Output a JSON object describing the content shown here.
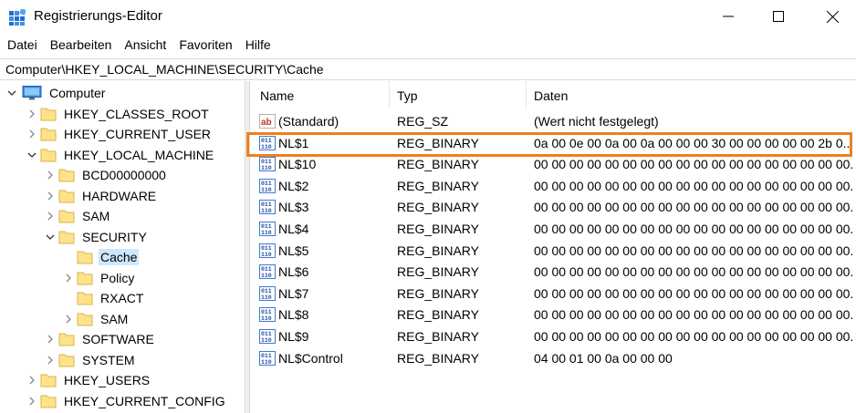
{
  "window": {
    "title": "Registrierungs-Editor"
  },
  "menu": [
    "Datei",
    "Bearbeiten",
    "Ansicht",
    "Favoriten",
    "Hilfe"
  ],
  "address": "Computer\\HKEY_LOCAL_MACHINE\\SECURITY\\Cache",
  "tree": [
    {
      "label": "Computer",
      "expanded": true
    },
    {
      "label": "HKEY_CLASSES_ROOT"
    },
    {
      "label": "HKEY_CURRENT_USER"
    },
    {
      "label": "HKEY_LOCAL_MACHINE",
      "expanded": true
    },
    {
      "label": "BCD00000000"
    },
    {
      "label": "HARDWARE"
    },
    {
      "label": "SAM"
    },
    {
      "label": "SECURITY",
      "expanded": true
    },
    {
      "label": "Cache",
      "selected": true
    },
    {
      "label": "Policy"
    },
    {
      "label": "RXACT"
    },
    {
      "label": "SAM"
    },
    {
      "label": "SOFTWARE"
    },
    {
      "label": "SYSTEM"
    },
    {
      "label": "HKEY_USERS"
    },
    {
      "label": "HKEY_CURRENT_CONFIG"
    }
  ],
  "columns": {
    "name": "Name",
    "type": "Typ",
    "data": "Daten"
  },
  "values": [
    {
      "name": "(Standard)",
      "type": "REG_SZ",
      "data": "(Wert nicht festgelegt)",
      "icon": "string-value-icon"
    },
    {
      "name": "NL$1",
      "type": "REG_BINARY",
      "data": "0a 00 0e 00 0a 00 0a 00 00 00 30 00 00 00 00 00 2b 0...",
      "icon": "binary-value-icon"
    },
    {
      "name": "NL$10",
      "type": "REG_BINARY",
      "data": "00 00 00 00 00 00 00 00 00 00 00 00 00 00 00 00 00 00...",
      "icon": "binary-value-icon"
    },
    {
      "name": "NL$2",
      "type": "REG_BINARY",
      "data": "00 00 00 00 00 00 00 00 00 00 00 00 00 00 00 00 00 00...",
      "icon": "binary-value-icon"
    },
    {
      "name": "NL$3",
      "type": "REG_BINARY",
      "data": "00 00 00 00 00 00 00 00 00 00 00 00 00 00 00 00 00 00...",
      "icon": "binary-value-icon"
    },
    {
      "name": "NL$4",
      "type": "REG_BINARY",
      "data": "00 00 00 00 00 00 00 00 00 00 00 00 00 00 00 00 00 00...",
      "icon": "binary-value-icon"
    },
    {
      "name": "NL$5",
      "type": "REG_BINARY",
      "data": "00 00 00 00 00 00 00 00 00 00 00 00 00 00 00 00 00 00...",
      "icon": "binary-value-icon"
    },
    {
      "name": "NL$6",
      "type": "REG_BINARY",
      "data": "00 00 00 00 00 00 00 00 00 00 00 00 00 00 00 00 00 00...",
      "icon": "binary-value-icon"
    },
    {
      "name": "NL$7",
      "type": "REG_BINARY",
      "data": "00 00 00 00 00 00 00 00 00 00 00 00 00 00 00 00 00 00...",
      "icon": "binary-value-icon"
    },
    {
      "name": "NL$8",
      "type": "REG_BINARY",
      "data": "00 00 00 00 00 00 00 00 00 00 00 00 00 00 00 00 00 00...",
      "icon": "binary-value-icon"
    },
    {
      "name": "NL$9",
      "type": "REG_BINARY",
      "data": "00 00 00 00 00 00 00 00 00 00 00 00 00 00 00 00 00 00...",
      "icon": "binary-value-icon"
    },
    {
      "name": "NL$Control",
      "type": "REG_BINARY",
      "data": "04 00 01 00 0a 00 00 00",
      "icon": "binary-value-icon"
    }
  ],
  "colors": {
    "highlight_border": "#f07f1c",
    "selection": "#cce8ff",
    "folder": "#ffe28a"
  }
}
